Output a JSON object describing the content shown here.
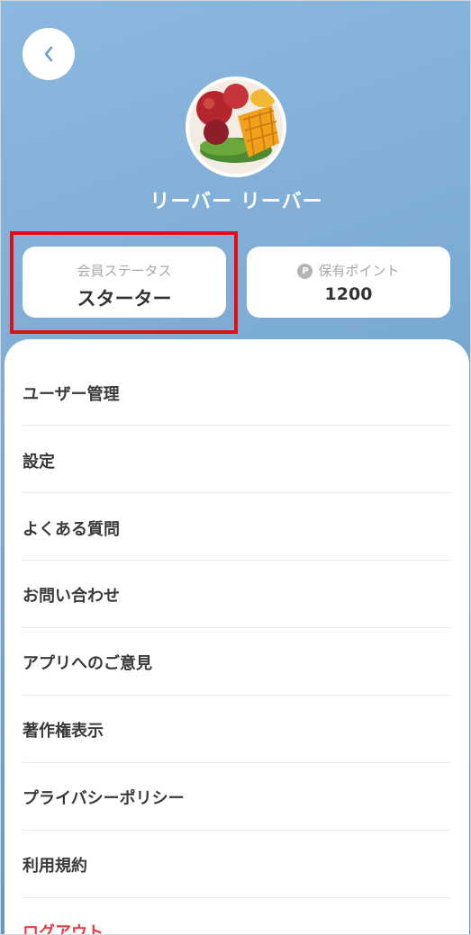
{
  "header": {
    "user_name": "リーバー リーバー"
  },
  "status_card": {
    "label": "会員ステータス",
    "value": "スターター"
  },
  "points_card": {
    "badge": "P",
    "label": "保有ポイント",
    "value": "1200"
  },
  "menu": {
    "items": [
      {
        "label": "ユーザー管理"
      },
      {
        "label": "設定"
      },
      {
        "label": "よくある質問"
      },
      {
        "label": "お問い合わせ"
      },
      {
        "label": "アプリへのご意見"
      },
      {
        "label": "著作権表示"
      },
      {
        "label": "プライバシーポリシー"
      },
      {
        "label": "利用規約"
      },
      {
        "label": "ログアウト"
      }
    ]
  },
  "colors": {
    "header_gradient_start": "#8cb8df",
    "header_gradient_end": "#5f93bb",
    "highlight_border": "#e10e18",
    "logout_text": "#e0404a"
  },
  "icons": {
    "back": "chevron-left-icon",
    "points": "point-badge-icon"
  }
}
